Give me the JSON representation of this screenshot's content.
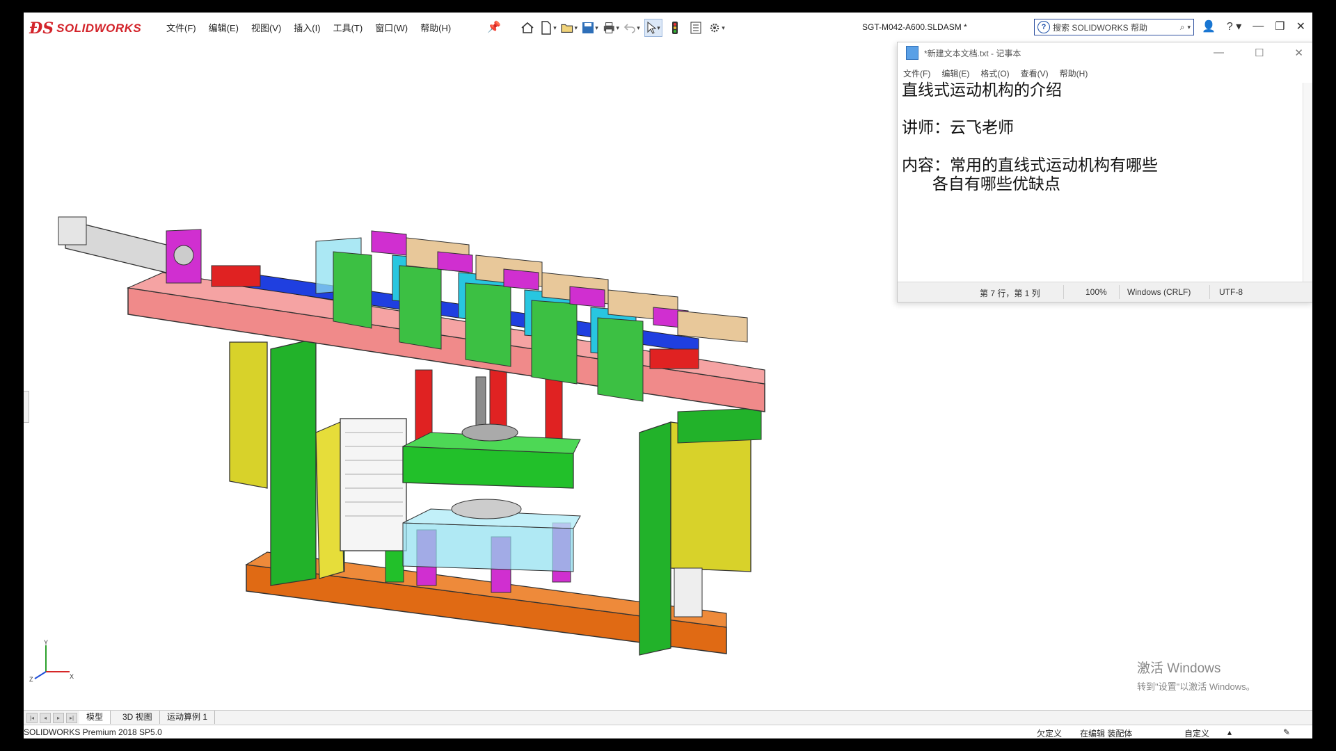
{
  "app": {
    "logo_text": "SOLIDWORKS",
    "document_title": "SGT-M042-A600.SLDASM *",
    "menus": [
      "文件(F)",
      "编辑(E)",
      "视图(V)",
      "插入(I)",
      "工具(T)",
      "窗口(W)",
      "帮助(H)"
    ],
    "search_placeholder": "搜索 SOLIDWORKS 帮助",
    "accent": "#d3232a"
  },
  "notepad": {
    "title": "*新建文本文档.txt - 记事本",
    "menus": [
      "文件(F)",
      "编辑(E)",
      "格式(O)",
      "查看(V)",
      "帮助(H)"
    ],
    "content": "直线式运动机构的介绍\n\n讲师：云飞老师\n\n内容：常用的直线式运动机构有哪些\n      各自有哪些优缺点",
    "status": {
      "position": "第 7 行，第 1 列",
      "zoom": "100%",
      "line_ending": "Windows (CRLF)",
      "encoding": "UTF-8"
    }
  },
  "bottom_tabs": [
    "模型",
    "3D 视图",
    "运动算例 1"
  ],
  "statusbar": {
    "product": "SOLIDWORKS Premium 2018 SP5.0",
    "undefined": "欠定义",
    "editing": "在编辑 装配体",
    "custom": "自定义"
  },
  "watermark": {
    "line1": "激活 Windows",
    "line2": "转到\"设置\"以激活 Windows。"
  },
  "axes": {
    "x": "X",
    "y": "Y",
    "z": "Z"
  }
}
